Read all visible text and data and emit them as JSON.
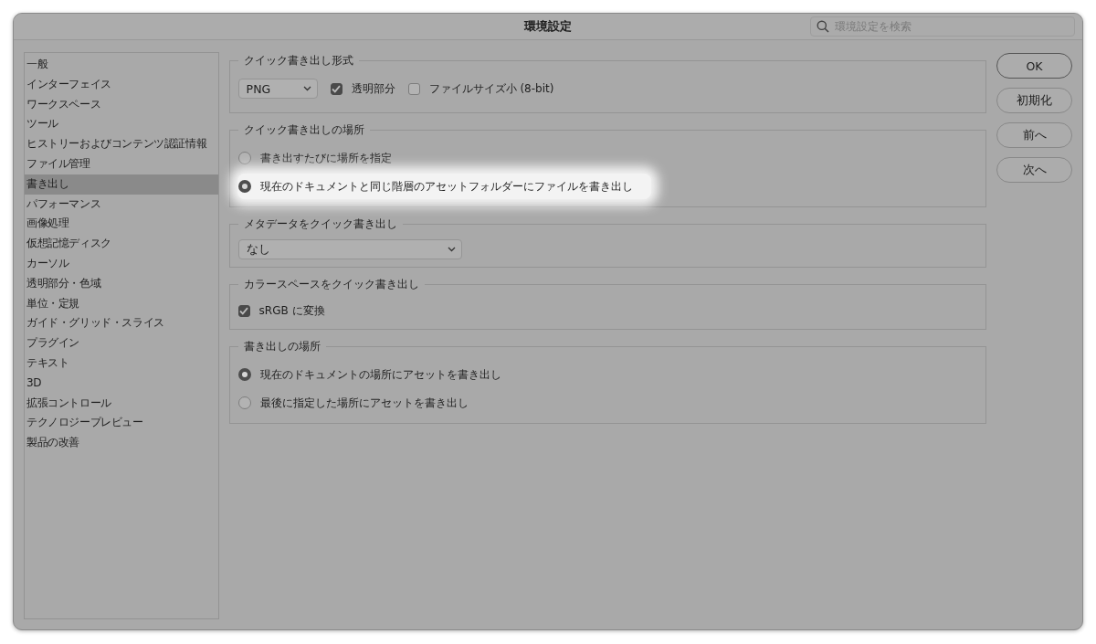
{
  "window": {
    "title": "環境設定"
  },
  "search": {
    "placeholder": "環境設定を検索"
  },
  "sidebar": {
    "items": [
      {
        "label": "一般",
        "selected": false
      },
      {
        "label": "インターフェイス",
        "selected": false
      },
      {
        "label": "ワークスペース",
        "selected": false
      },
      {
        "label": "ツール",
        "selected": false
      },
      {
        "label": "ヒストリーおよびコンテンツ認証情報",
        "selected": false
      },
      {
        "label": "ファイル管理",
        "selected": false
      },
      {
        "label": "書き出し",
        "selected": true
      },
      {
        "label": "パフォーマンス",
        "selected": false
      },
      {
        "label": "画像処理",
        "selected": false
      },
      {
        "label": "仮想記憶ディスク",
        "selected": false
      },
      {
        "label": "カーソル",
        "selected": false
      },
      {
        "label": "透明部分・色域",
        "selected": false
      },
      {
        "label": "単位・定規",
        "selected": false
      },
      {
        "label": "ガイド・グリッド・スライス",
        "selected": false
      },
      {
        "label": "プラグイン",
        "selected": false
      },
      {
        "label": "テキスト",
        "selected": false
      },
      {
        "label": "3D",
        "selected": false
      },
      {
        "label": "拡張コントロール",
        "selected": false
      },
      {
        "label": "テクノロジープレビュー",
        "selected": false
      },
      {
        "label": "製品の改善",
        "selected": false
      }
    ]
  },
  "sections": [
    {
      "title": "クイック書き出し形式",
      "kind": "inline",
      "items": [
        {
          "kind": "select",
          "value": "PNG"
        },
        {
          "kind": "checkbox",
          "label": "透明部分",
          "checked": true
        },
        {
          "kind": "checkbox",
          "label": "ファイルサイズ小 (8-bit)",
          "checked": false
        }
      ]
    },
    {
      "title": "クイック書き出しの場所",
      "kind": "stacked",
      "items": [
        {
          "kind": "radio",
          "label": "書き出すたびに場所を指定",
          "selected": false,
          "highlighted": false
        },
        {
          "kind": "radio",
          "label": "現在のドキュメントと同じ階層のアセットフォルダーにファイルを書き出し",
          "selected": true,
          "highlighted": true
        }
      ]
    },
    {
      "title": "メタデータをクイック書き出し",
      "kind": "stacked",
      "items": [
        {
          "kind": "select",
          "value": "なし"
        }
      ]
    },
    {
      "title": "カラースペースをクイック書き出し",
      "kind": "stacked",
      "items": [
        {
          "kind": "checkbox",
          "label": "sRGB に変換",
          "checked": true
        }
      ]
    },
    {
      "title": "書き出しの場所",
      "kind": "stacked",
      "items": [
        {
          "kind": "radio",
          "label": "現在のドキュメントの場所にアセットを書き出し",
          "selected": true,
          "highlighted": false
        },
        {
          "kind": "radio",
          "label": "最後に指定した場所にアセットを書き出し",
          "selected": false,
          "highlighted": false
        }
      ]
    }
  ],
  "buttons": [
    {
      "label": "OK",
      "default": true
    },
    {
      "label": "初期化",
      "default": false
    },
    {
      "label": "前へ",
      "default": false
    },
    {
      "label": "次へ",
      "default": false
    }
  ]
}
